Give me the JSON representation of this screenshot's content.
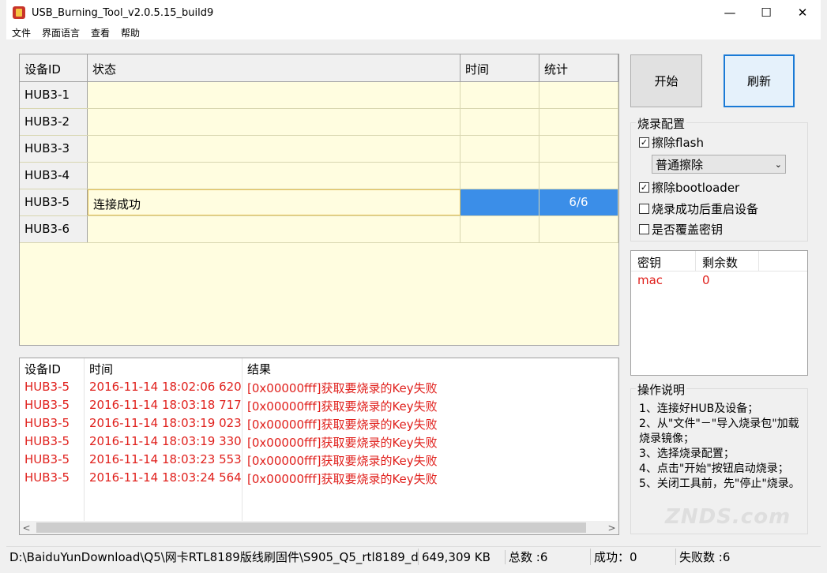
{
  "window": {
    "title": "USB_Burning_Tool_v2.0.5.15_build9",
    "minimize": "—",
    "maximize": "☐",
    "close": "✕"
  },
  "menu": [
    "文件",
    "界面语言",
    "查看",
    "帮助"
  ],
  "grid": {
    "headers": [
      "设备ID",
      "状态",
      "时间",
      "统计"
    ],
    "rows": [
      {
        "id": "HUB3-1",
        "status": "",
        "time": "",
        "stat": ""
      },
      {
        "id": "HUB3-2",
        "status": "",
        "time": "",
        "stat": ""
      },
      {
        "id": "HUB3-3",
        "status": "",
        "time": "",
        "stat": ""
      },
      {
        "id": "HUB3-4",
        "status": "",
        "time": "",
        "stat": ""
      },
      {
        "id": "HUB3-5",
        "status": "连接成功",
        "time": "",
        "stat": "6/6"
      },
      {
        "id": "HUB3-6",
        "status": "",
        "time": "",
        "stat": ""
      }
    ]
  },
  "buttons": {
    "start": "开始",
    "refresh": "刷新"
  },
  "config": {
    "title": "烧录配置",
    "erase_flash": "擦除flash",
    "erase_mode": "普通擦除",
    "erase_bootloader": "擦除bootloader",
    "reboot_after": "烧录成功后重启设备",
    "overwrite_key": "是否覆盖密钥"
  },
  "keys": {
    "headers": [
      "密钥",
      "剩余数"
    ],
    "rows": [
      {
        "name": "mac",
        "count": "0"
      }
    ]
  },
  "help": {
    "title": "操作说明",
    "text": "1、连接好HUB及设备；\n2、从\"文件\"－\"导入烧录包\"加载烧录镜像；\n3、选择烧录配置；\n4、点击\"开始\"按钮启动烧录；\n5、关闭工具前，先\"停止\"烧录。"
  },
  "log": {
    "headers": [
      "设备ID",
      "时间",
      "结果"
    ],
    "rows": [
      {
        "id": "HUB3-5",
        "time": "2016-11-14 18:02:06 620",
        "result": "[0x00000fff]获取要烧录的Key失败"
      },
      {
        "id": "HUB3-5",
        "time": "2016-11-14 18:03:18 717",
        "result": "[0x00000fff]获取要烧录的Key失败"
      },
      {
        "id": "HUB3-5",
        "time": "2016-11-14 18:03:19 023",
        "result": "[0x00000fff]获取要烧录的Key失败"
      },
      {
        "id": "HUB3-5",
        "time": "2016-11-14 18:03:19 330",
        "result": "[0x00000fff]获取要烧录的Key失败"
      },
      {
        "id": "HUB3-5",
        "time": "2016-11-14 18:03:23 553",
        "result": "[0x00000fff]获取要烧录的Key失败"
      },
      {
        "id": "HUB3-5",
        "time": "2016-11-14 18:03:24 564",
        "result": "[0x00000fff]获取要烧录的Key失败"
      }
    ]
  },
  "status": {
    "path": "D:\\BaiduYunDownload\\Q5\\网卡RTL8189版线刷固件\\S905_Q5_rtl8189_d",
    "size": "649,309 KB",
    "total": "总数 :6",
    "success": "成功：0",
    "fail": "失败数 :6"
  },
  "watermark": "ZNDS.com"
}
